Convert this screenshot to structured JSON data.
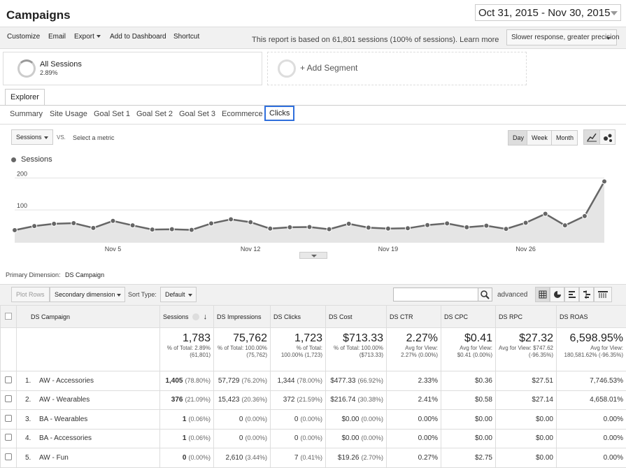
{
  "page": {
    "title": "Campaigns",
    "date_range": "Oct 31, 2015 - Nov 30, 2015"
  },
  "toolbar": {
    "customize": "Customize",
    "email": "Email",
    "export": "Export",
    "add_dashboard": "Add to Dashboard",
    "shortcut": "Shortcut",
    "report_note": "This report is based on 61,801 sessions (100% of sessions). Learn more",
    "precision": "Slower response, greater precision"
  },
  "segments": [
    {
      "name": "All Sessions",
      "pct": "2.89%"
    },
    {
      "name": "+ Add Segment",
      "pct": ""
    }
  ],
  "explorer_tab": "Explorer",
  "subtabs": [
    "Summary",
    "Site Usage",
    "Goal Set 1",
    "Goal Set 2",
    "Goal Set 3",
    "Ecommerce",
    "Clicks"
  ],
  "metric_controls": {
    "metric": "Sessions",
    "vs": "VS.",
    "select_metric": "Select a metric",
    "day": "Day",
    "week": "Week",
    "month": "Month"
  },
  "chart_data": {
    "type": "area",
    "legend": "Sessions",
    "y_ticks": [
      "200",
      "100"
    ],
    "ylim": [
      0,
      240
    ],
    "x_tick_labels": [
      "Nov 5",
      "Nov 12",
      "Nov 19",
      "Nov 26"
    ],
    "x": [
      "Oct 31",
      "Nov 1",
      "Nov 2",
      "Nov 3",
      "Nov 4",
      "Nov 5",
      "Nov 6",
      "Nov 7",
      "Nov 8",
      "Nov 9",
      "Nov 10",
      "Nov 11",
      "Nov 12",
      "Nov 13",
      "Nov 14",
      "Nov 15",
      "Nov 16",
      "Nov 17",
      "Nov 18",
      "Nov 19",
      "Nov 20",
      "Nov 21",
      "Nov 22",
      "Nov 23",
      "Nov 24",
      "Nov 25",
      "Nov 26",
      "Nov 27",
      "Nov 28",
      "Nov 29",
      "Nov 30"
    ],
    "values": [
      37,
      50,
      57,
      59,
      44,
      66,
      52,
      39,
      40,
      38,
      58,
      71,
      62,
      42,
      46,
      47,
      40,
      57,
      45,
      42,
      43,
      53,
      58,
      46,
      51,
      41,
      60,
      88,
      52,
      81,
      189
    ]
  },
  "table": {
    "primary_dimension_label": "Primary Dimension:",
    "primary_dimension": "DS Campaign",
    "plot_rows": "Plot Rows",
    "secondary_dimension": "Secondary dimension",
    "sort_type_label": "Sort Type:",
    "sort_type": "Default",
    "advanced": "advanced",
    "headers": [
      "DS Campaign",
      "Sessions",
      "DS Impressions",
      "DS Clicks",
      "DS Cost",
      "DS CTR",
      "DS CPC",
      "DS RPC",
      "DS ROAS"
    ],
    "totals": [
      {
        "big": "1,783",
        "small": "% of Total: 2.89% (61,801)"
      },
      {
        "big": "75,762",
        "small": "% of Total: 100.00% (75,762)"
      },
      {
        "big": "1,723",
        "small": "% of Total: 100.00% (1,723)"
      },
      {
        "big": "$713.33",
        "small": "% of Total: 100.00% ($713.33)"
      },
      {
        "big": "2.27%",
        "small": "Avg for View: 2.27% (0.00%)"
      },
      {
        "big": "$0.41",
        "small": "Avg for View: $0.41 (0.00%)"
      },
      {
        "big": "$27.32",
        "small": "Avg for View: $747.62 (-96.35%)"
      },
      {
        "big": "6,598.95%",
        "small": "Avg for View: 180,581.62% (-96.35%)"
      }
    ],
    "rows": [
      {
        "idx": "1.",
        "name": "AW - Accessories",
        "sessions": "1,405",
        "sessions_pct": "(78.80%)",
        "impr": "57,729",
        "impr_pct": "(76.20%)",
        "clicks": "1,344",
        "clicks_pct": "(78.00%)",
        "cost": "$477.33",
        "cost_pct": "(66.92%)",
        "ctr": "2.33%",
        "cpc": "$0.36",
        "rpc": "$27.51",
        "roas": "7,746.53%"
      },
      {
        "idx": "2.",
        "name": "AW - Wearables",
        "sessions": "376",
        "sessions_pct": "(21.09%)",
        "impr": "15,423",
        "impr_pct": "(20.36%)",
        "clicks": "372",
        "clicks_pct": "(21.59%)",
        "cost": "$216.74",
        "cost_pct": "(30.38%)",
        "ctr": "2.41%",
        "cpc": "$0.58",
        "rpc": "$27.14",
        "roas": "4,658.01%"
      },
      {
        "idx": "3.",
        "name": "BA - Wearables",
        "sessions": "1",
        "sessions_pct": "(0.06%)",
        "impr": "0",
        "impr_pct": "(0.00%)",
        "clicks": "0",
        "clicks_pct": "(0.00%)",
        "cost": "$0.00",
        "cost_pct": "(0.00%)",
        "ctr": "0.00%",
        "cpc": "$0.00",
        "rpc": "$0.00",
        "roas": "0.00%"
      },
      {
        "idx": "4.",
        "name": "BA - Accessories",
        "sessions": "1",
        "sessions_pct": "(0.06%)",
        "impr": "0",
        "impr_pct": "(0.00%)",
        "clicks": "0",
        "clicks_pct": "(0.00%)",
        "cost": "$0.00",
        "cost_pct": "(0.00%)",
        "ctr": "0.00%",
        "cpc": "$0.00",
        "rpc": "$0.00",
        "roas": "0.00%"
      },
      {
        "idx": "5.",
        "name": "AW - Fun",
        "sessions": "0",
        "sessions_pct": "(0.00%)",
        "impr": "2,610",
        "impr_pct": "(3.44%)",
        "clicks": "7",
        "clicks_pct": "(0.41%)",
        "cost": "$19.26",
        "cost_pct": "(2.70%)",
        "ctr": "0.27%",
        "cpc": "$2.75",
        "rpc": "$0.00",
        "roas": "0.00%"
      }
    ]
  }
}
